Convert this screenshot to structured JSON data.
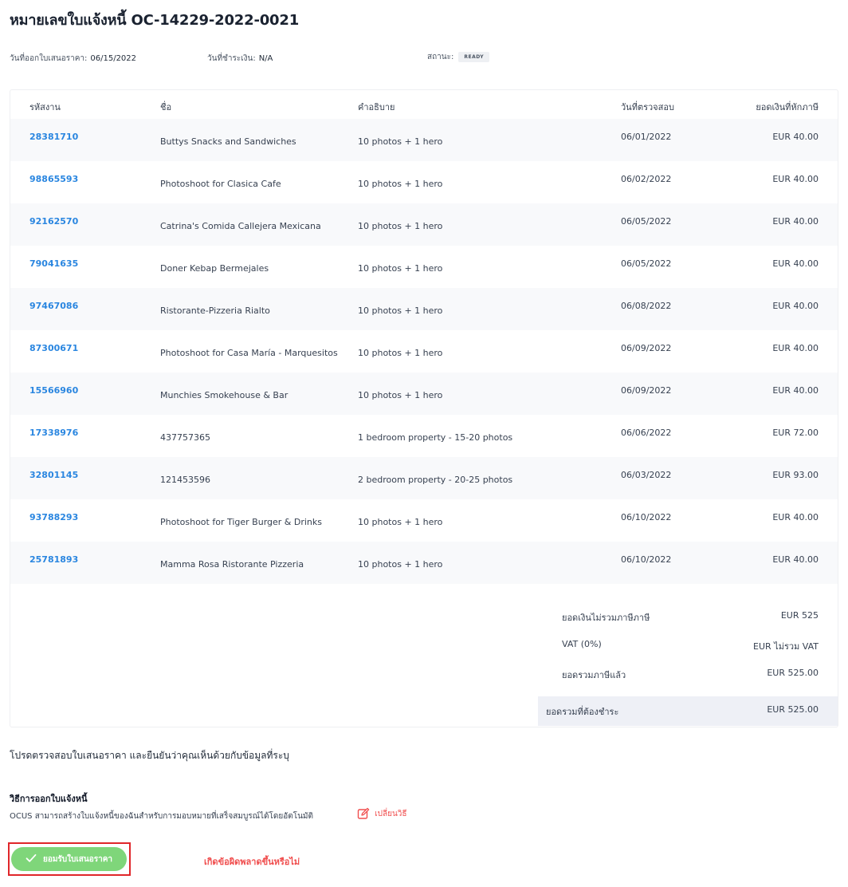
{
  "page": {
    "title": "หมายเลขใบแจ้งหนี้ OC-14229-2022-0021"
  },
  "meta": {
    "issue_date_label": "วันที่ออกใบเสนอราคา:",
    "issue_date": "06/15/2022",
    "payment_date_label": "วันที่ชำระเงิน:",
    "payment_date": "N/A",
    "status_label": "สถานะ:",
    "status": "READY"
  },
  "table": {
    "headers": [
      "รหัสงาน",
      "ชื่อ",
      "คำอธิบาย",
      "วันที่ตรวจสอบ",
      "ยอดเงินที่หักภาษี"
    ],
    "rows": [
      {
        "job_id": "28381710",
        "name": "Buttys Snacks and Sandwiches",
        "description": "10 photos + 1 hero",
        "date": "06/01/2022",
        "amount": "EUR 40.00"
      },
      {
        "job_id": "98865593",
        "name": "Photoshoot for Clasica Cafe",
        "description": "10 photos + 1 hero",
        "date": "06/02/2022",
        "amount": "EUR 40.00"
      },
      {
        "job_id": "92162570",
        "name": "Catrina's Comida Callejera Mexicana",
        "description": "10 photos + 1 hero",
        "date": "06/05/2022",
        "amount": "EUR 40.00"
      },
      {
        "job_id": "79041635",
        "name": "Doner Kebap Bermejales",
        "description": "10 photos + 1 hero",
        "date": "06/05/2022",
        "amount": "EUR 40.00"
      },
      {
        "job_id": "97467086",
        "name": "Ristorante-Pizzeria Rialto",
        "description": "10 photos + 1 hero",
        "date": "06/08/2022",
        "amount": "EUR 40.00"
      },
      {
        "job_id": "87300671",
        "name": "Photoshoot for Casa María - Marquesitos",
        "description": "10 photos + 1 hero",
        "date": "06/09/2022",
        "amount": "EUR 40.00"
      },
      {
        "job_id": "15566960",
        "name": "Munchies Smokehouse & Bar",
        "description": "10 photos + 1 hero",
        "date": "06/09/2022",
        "amount": "EUR 40.00"
      },
      {
        "job_id": "17338976",
        "name": "437757365",
        "description": "1 bedroom property - 15-20 photos",
        "date": "06/06/2022",
        "amount": "EUR 72.00"
      },
      {
        "job_id": "32801145",
        "name": "121453596",
        "description": "2 bedroom property - 20-25 photos",
        "date": "06/03/2022",
        "amount": "EUR 93.00"
      },
      {
        "job_id": "93788293",
        "name": "Photoshoot for Tiger Burger & Drinks",
        "description": "10 photos + 1 hero",
        "date": "06/10/2022",
        "amount": "EUR 40.00"
      },
      {
        "job_id": "25781893",
        "name": "Mamma Rosa Ristorante Pizzeria",
        "description": "10 photos + 1 hero",
        "date": "06/10/2022",
        "amount": "EUR 40.00"
      }
    ]
  },
  "totals": {
    "subtotal_label": "ยอดเงินไม่รวมภาษีภาษี",
    "subtotal": "EUR 525",
    "vat_label": "VAT (0%)",
    "vat": "EUR ไม่รวม VAT",
    "total_label": "ยอดรวมภาษีแล้ว",
    "total": "EUR 525.00",
    "due_label": "ยอดรวมที่ต้องชำระ",
    "due": "EUR 525.00"
  },
  "confirm_text": "โปรดตรวจสอบใบเสนอราคา และยืนยันว่าคุณเห็นด้วยกับข้อมูลที่ระบุ",
  "invoicing": {
    "heading": "วิธีการออกใบแจ้งหนี้",
    "description": "OCUS สามารถสร้างใบแจ้งหนี้ของฉันสำหรับการมอบหมายที่เสร็จสมบูรณ์ได้โดยอัตโนมัติ",
    "change_label": "เปลี่ยนวิธี"
  },
  "actions": {
    "accept_label": "ยอมรับใบเสนอราคา",
    "error_label": "เกิดข้อผิดพลาดขึ้นหรือไม่"
  },
  "colors": {
    "link_blue": "#2a86e0",
    "accept_green": "#7fd67a",
    "error_red": "#f04e4e",
    "highlight_red": "#e0262a"
  },
  "icons": {
    "accept": "check-icon",
    "change": "edit-icon"
  }
}
